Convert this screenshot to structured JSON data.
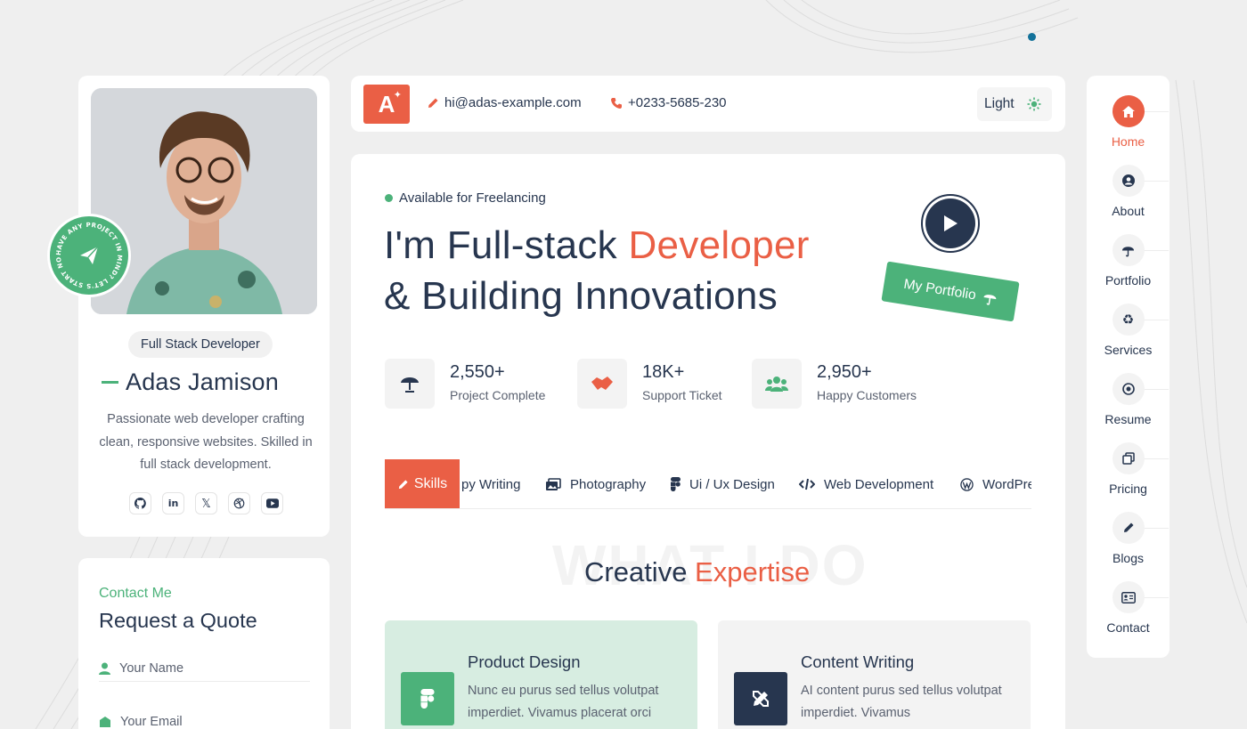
{
  "colors": {
    "accent": "#ea5f45",
    "green": "#4cb27a",
    "navy": "#27364f",
    "teal_dot": "#13729a"
  },
  "profile": {
    "role": "Full Stack Developer",
    "name": "Adas Jamison",
    "bio": "Passionate web developer crafting clean, responsive websites. Skilled in full stack development.",
    "badge_text": "HAVE ANY PROJECT IN MIND? LET'S START NOW.",
    "socials": [
      "github-icon",
      "linkedin-icon",
      "x-icon",
      "dribbble-icon",
      "youtube-icon"
    ]
  },
  "quote": {
    "eyebrow": "Contact Me",
    "title": "Request a Quote",
    "name_placeholder": "Your Name",
    "email_placeholder": "Your Email"
  },
  "topbar": {
    "logo": "A",
    "email": "hi@adas-example.com",
    "phone": "+0233-5685-230",
    "theme_label": "Light"
  },
  "hero": {
    "availability": "Available for Freelancing",
    "headline_1a": "I'm Full-stack ",
    "headline_1b": "Developer",
    "headline_2": "& Building Innovations",
    "portfolio_label": "My Portfolio",
    "stats": [
      {
        "value": "2,550+",
        "label": "Project Complete",
        "icon": "umbrella-icon"
      },
      {
        "value": "18K+",
        "label": "Support Ticket",
        "icon": "handshake-icon"
      },
      {
        "value": "2,950+",
        "label": "Happy Customers",
        "icon": "users-icon"
      }
    ],
    "tabs": {
      "active": "Skills",
      "items": [
        "py Writing",
        "Photography",
        "Ui / Ux Design",
        "Web Development",
        "WordPre"
      ]
    },
    "ghost_text": "WHAT I DO",
    "section_title_a": "Creative ",
    "section_title_b": "Expertise",
    "services": [
      {
        "title": "Product Design",
        "desc": "Nunc eu purus sed tellus volutpat imperdiet. Vivamus placerat orci",
        "icon": "figma-icon"
      },
      {
        "title": "Content Writing",
        "desc": "AI content purus sed tellus volutpat imperdiet. Vivamus",
        "icon": "pen-ruler-icon"
      }
    ]
  },
  "nav": {
    "items": [
      {
        "label": "Home",
        "icon": "home-icon",
        "active": true
      },
      {
        "label": "About",
        "icon": "user-icon"
      },
      {
        "label": "Portfolio",
        "icon": "umbrella-icon"
      },
      {
        "label": "Services",
        "icon": "recycle-icon"
      },
      {
        "label": "Resume",
        "icon": "target-icon"
      },
      {
        "label": "Pricing",
        "icon": "copy-icon"
      },
      {
        "label": "Blogs",
        "icon": "pencil-icon"
      },
      {
        "label": "Contact",
        "icon": "id-card-icon"
      }
    ]
  }
}
